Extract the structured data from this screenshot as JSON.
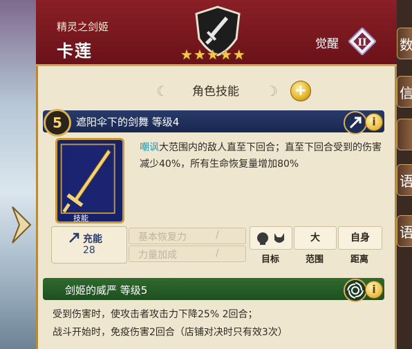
{
  "header": {
    "subtitle": "精灵之剑姬",
    "name": "卡莲",
    "stars": 5,
    "awaken_label": "觉醒",
    "awaken_level": "II"
  },
  "right_tabs": [
    "数",
    "信",
    "",
    "语",
    "语"
  ],
  "section": {
    "title": "角色技能"
  },
  "skill1": {
    "number": "5",
    "title": "遮阳伞下的剑舞 等级4",
    "card_label": "技能",
    "keyword": "嘲讽",
    "description": "大范围内的敌人直至下回合；直至下回合受到的伤害减少40%，所有生命恢复量增加80%",
    "charge_label": "充能",
    "charge_value": "28",
    "stats": [
      {
        "label": "基本恢复力",
        "value": "/"
      },
      {
        "label": "力量加成",
        "value": "/"
      }
    ],
    "target_label": "目标",
    "range_value": "大",
    "range_label": "范围",
    "distance_value": "自身",
    "distance_label": "距离"
  },
  "skill2": {
    "title": "剑姬的威严 等级5",
    "lines": [
      "受到伤害时，使攻击者攻击力下降25% 2回合；",
      "战斗开始时，免疫伤害2回合（店铺对决时只有效3次）"
    ]
  }
}
